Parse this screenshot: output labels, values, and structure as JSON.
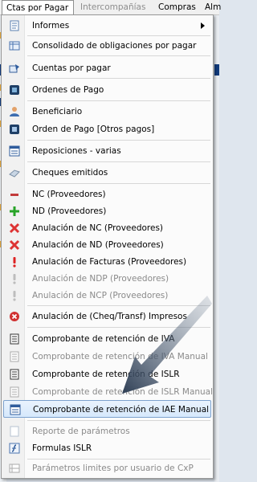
{
  "menubar": {
    "items": [
      {
        "label": "Ctas por Pagar",
        "active": true
      },
      {
        "label": "Intercompañías",
        "disabled": true
      },
      {
        "label": "Compras"
      },
      {
        "label": "Alm"
      }
    ]
  },
  "dropdown": {
    "items": [
      {
        "label": "Informes",
        "icon": "report-icon",
        "submenu": true
      },
      {
        "label": "Consolidado de obligaciones por pagar",
        "icon": "table-icon"
      },
      {
        "label": "Cuentas por pagar",
        "icon": "accounts-icon"
      },
      {
        "label": "Ordenes de Pago",
        "icon": "payment-order-icon"
      },
      {
        "label": "Beneficiario",
        "icon": "person-icon"
      },
      {
        "label": "Orden de Pago [Otros pagos]",
        "icon": "document-icon"
      },
      {
        "label": "Reposiciones - varias",
        "icon": "window-icon"
      },
      {
        "label": "Cheques emitidos",
        "icon": "check-icon"
      },
      {
        "label": "NC (Proveedores)",
        "icon": "minus-icon"
      },
      {
        "label": "ND (Proveedores)",
        "icon": "plus-icon"
      },
      {
        "label": "Anulación de NC (Proveedores)",
        "icon": "x-icon"
      },
      {
        "label": "Anulación de ND (Proveedores)",
        "icon": "x-icon"
      },
      {
        "label": "Anulación de Facturas (Proveedores)",
        "icon": "exclamation-icon"
      },
      {
        "label": "Anulación de NDP (Proveedores)",
        "icon": "exclamation-icon",
        "disabled": true
      },
      {
        "label": "Anulación de NCP (Proveedores)",
        "icon": "exclamation-icon",
        "disabled": true
      },
      {
        "label": "Anulación de (Cheq/Transf) Impresos",
        "icon": "cancel-circle-icon"
      },
      {
        "label": "Comprobante de retención de IVA",
        "icon": "receipt-icon"
      },
      {
        "label": "Comprobante de retención de IVA Manual",
        "icon": "receipt-icon",
        "disabled": true
      },
      {
        "label": "Comprobante de retención de ISLR",
        "icon": "receipt-icon"
      },
      {
        "label": "Comprobante de retención de ISLR Manual",
        "icon": "receipt-icon",
        "disabled": true
      },
      {
        "label": "Comprobante de retención de IAE Manual",
        "icon": "window-icon",
        "highlighted": true
      },
      {
        "label": "Reporte de parámetros",
        "icon": "page-icon",
        "disabled": true
      },
      {
        "label": "Formulas ISLR",
        "icon": "formula-icon"
      },
      {
        "label": "Parámetros limites por usuario de CxP",
        "icon": "params-icon",
        "disabled": true
      }
    ]
  },
  "colors": {
    "highlight_border": "#7da2ce",
    "disabled_text": "#8a8a8a",
    "pointer": "#3d4e63"
  }
}
